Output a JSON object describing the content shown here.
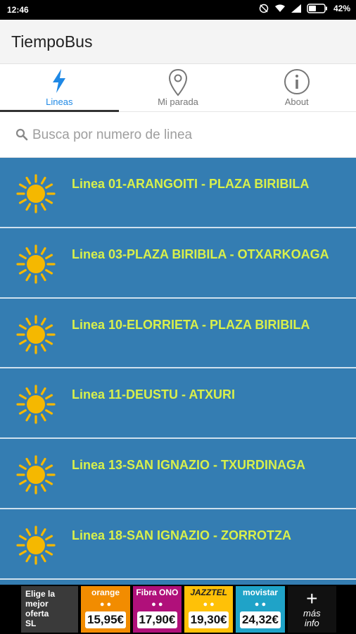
{
  "status_bar": {
    "time": "12:46",
    "battery_percent": "42%",
    "icons": [
      "do-not-disturb-icon",
      "wifi-icon",
      "signal-icon",
      "battery-icon"
    ]
  },
  "app": {
    "title": "TiempoBus"
  },
  "tabs": [
    {
      "label": "Lineas",
      "icon": "lightning-icon",
      "active": true
    },
    {
      "label": "Mi parada",
      "icon": "location-pin-icon",
      "active": false
    },
    {
      "label": "About",
      "icon": "info-icon",
      "active": false
    }
  ],
  "search": {
    "placeholder": "Busca por numero de linea",
    "value": ""
  },
  "lines": [
    {
      "label": "Linea 01-ARANGOITI - PLAZA BIRIBILA",
      "icon": "sun-icon"
    },
    {
      "label": "Linea 03-PLAZA BIRIBILA - OTXARKOAGA",
      "icon": "sun-icon"
    },
    {
      "label": "Linea 10-ELORRIETA - PLAZA BIRIBILA",
      "icon": "sun-icon"
    },
    {
      "label": "Linea 11-DEUSTU - ATXURI",
      "icon": "sun-icon"
    },
    {
      "label": "Linea 13-SAN IGNAZIO - TXURDINAGA",
      "icon": "sun-icon"
    },
    {
      "label": "Linea 18-SAN IGNAZIO - ZORROTZA",
      "icon": "sun-icon"
    }
  ],
  "ad": {
    "intro_lines": [
      "Elige la",
      "mejor",
      "oferta",
      "SL"
    ],
    "offers": [
      {
        "brand": "orange",
        "price": "15,95€"
      },
      {
        "brand": "Fibra ONO",
        "price": "17,90€"
      },
      {
        "brand": "JAZZTEL",
        "price": "19,30€"
      },
      {
        "brand": "movistar",
        "price": "24,32€"
      }
    ],
    "more": {
      "plus": "+",
      "line1": "más",
      "line2": "info"
    }
  },
  "colors": {
    "list_background": "#347db2",
    "line_text": "#d9f04a",
    "active_tab": "#1e88e5",
    "sun": "#f5b800"
  }
}
